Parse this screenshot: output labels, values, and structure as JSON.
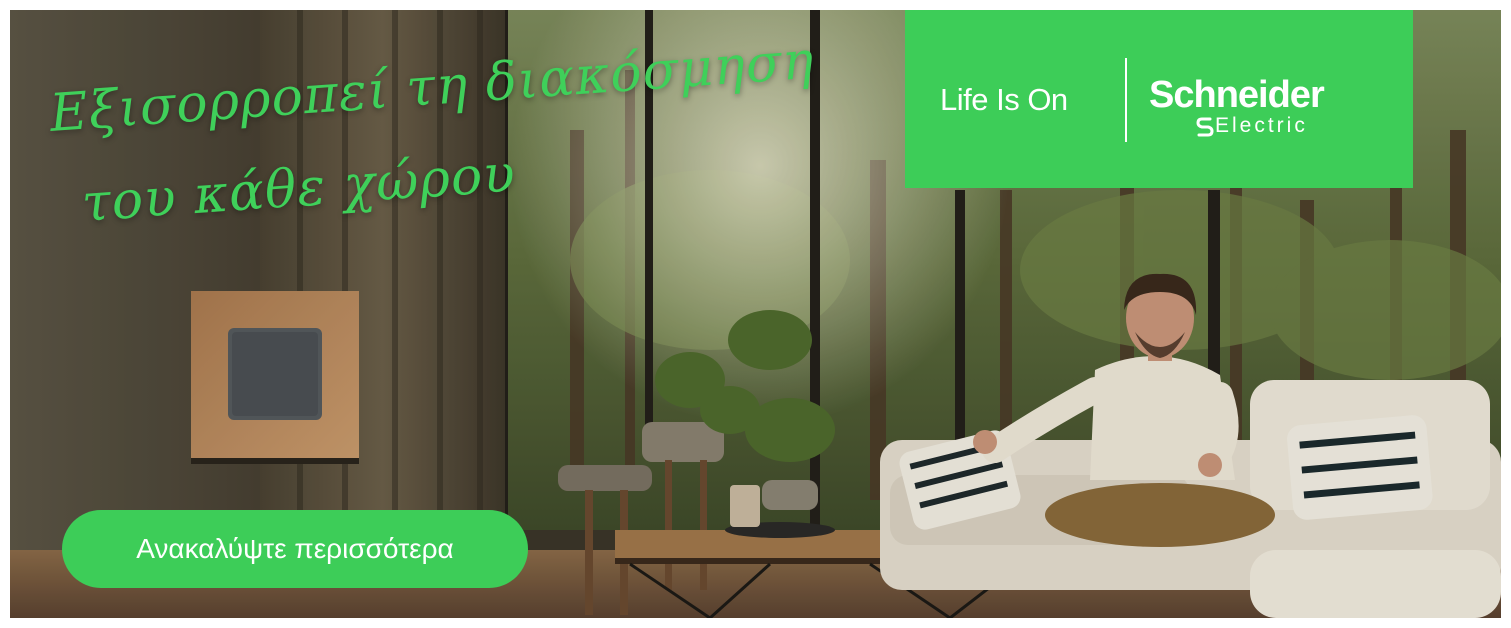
{
  "headline": {
    "line_1": "Εξισορροπεί τη διακόσμηση",
    "line_2": "του κάθε χώρου"
  },
  "logo": {
    "tagline": "Life Is On",
    "brand_name": "Schneider",
    "brand_sub": "Electric"
  },
  "cta": {
    "label": "Ανακαλύψτε περισσότερα"
  },
  "colors": {
    "brand_green": "#3dcd58",
    "headline_green": "#3fd05a",
    "text_on_green": "#ffffff"
  }
}
